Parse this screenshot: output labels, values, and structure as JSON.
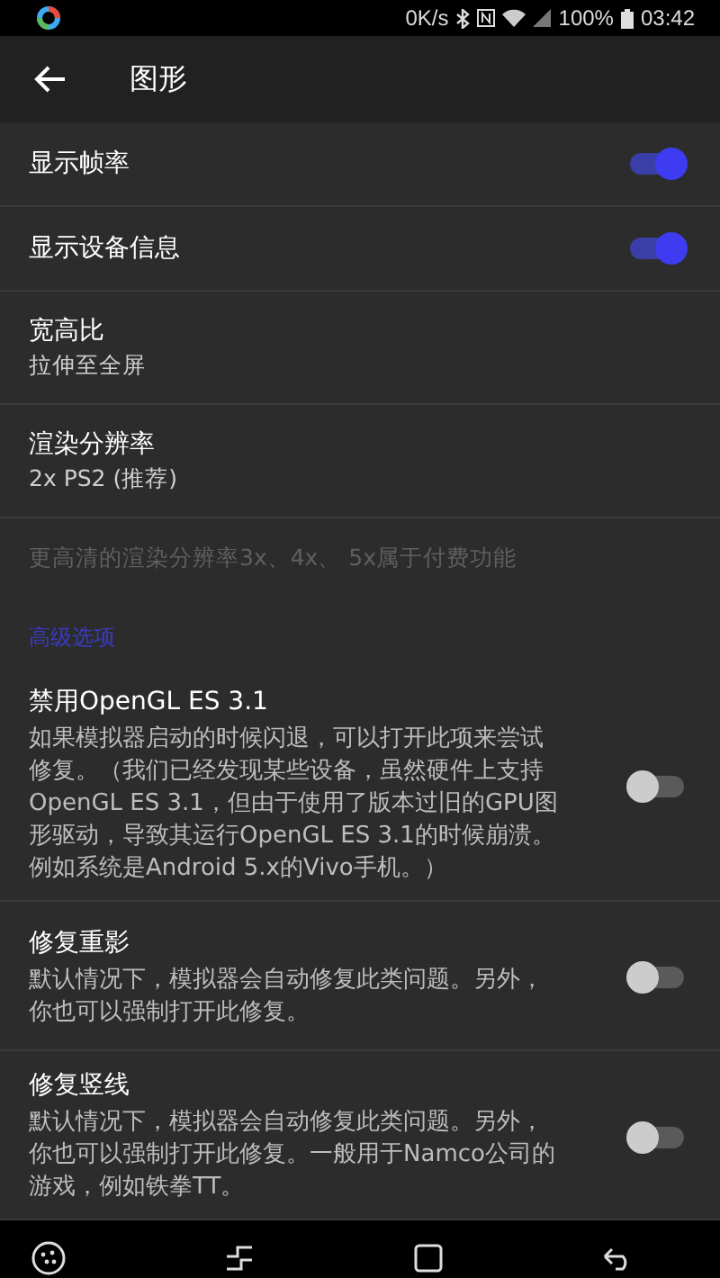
{
  "status_bar": {
    "speed": "0K/s",
    "battery": "100%",
    "time": "03:42"
  },
  "toolbar": {
    "title": "图形"
  },
  "settings": [
    {
      "kind": "switch",
      "title": "显示帧率",
      "on": true
    },
    {
      "kind": "switch",
      "title": "显示设备信息",
      "on": true
    },
    {
      "kind": "value",
      "title": "宽高比",
      "value": "拉伸至全屏"
    },
    {
      "kind": "value",
      "title": "渲染分辨率",
      "value": "2x PS2 (推荐)"
    },
    {
      "kind": "note",
      "text": "更高清的渲染分辨率3x、4x、 5x属于付费功能"
    },
    {
      "kind": "header",
      "text": "高级选项"
    },
    {
      "kind": "switch",
      "title": "禁用OpenGL ES 3.1",
      "summary": "如果模拟器启动的时候闪退，可以打开此项来尝试修复。（我们已经发现某些设备，虽然硬件上支持OpenGL ES 3.1，但由于使用了版本过旧的GPU图形驱动，导致其运行OpenGL ES 3.1的时候崩溃。例如系统是Android 5.x的Vivo手机。）",
      "on": false
    },
    {
      "kind": "switch",
      "title": "修复重影",
      "summary": "默认情况下，模拟器会自动修复此类问题。另外，你也可以强制打开此修复。",
      "on": false
    },
    {
      "kind": "switch",
      "title": "修复竖线",
      "summary": "默认情况下，模拟器会自动修复此类问题。另外，你也可以强制打开此修复。一般用于Namco公司的游戏，例如铁拳TT。",
      "on": false
    }
  ]
}
